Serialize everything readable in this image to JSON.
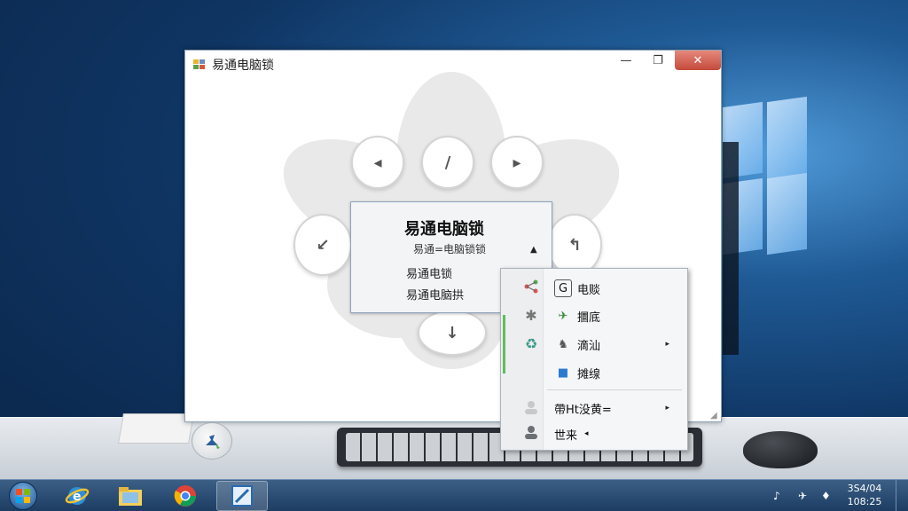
{
  "window": {
    "title": "易通电脑锁",
    "minimize": "—",
    "maximize": "❐",
    "close": "✕"
  },
  "flower_buttons": [
    "◂",
    "/",
    "▸",
    "↙",
    "↰",
    "↓"
  ],
  "panel": {
    "title": "易通电脑锁",
    "subtitle": "易通=电脑锁锁",
    "arrow": "▲",
    "line1": "易通电锁",
    "line2": "易通电脑拱"
  },
  "context_menu": {
    "items": [
      {
        "icon": "G",
        "label": "电赕",
        "has_sub": false
      },
      {
        "icon": "✈",
        "label": "攌底",
        "has_sub": false
      },
      {
        "icon": "♞",
        "label": "滴汕",
        "has_sub": true
      },
      {
        "icon": "■",
        "label": "摊缐",
        "has_sub": false
      }
    ],
    "bottom_items": [
      {
        "label": "帶Ht没黄=",
        "has_sub": true
      },
      {
        "label": "世来",
        "has_sub": true
      }
    ],
    "sub_arrow": "▸",
    "back_arrow": "◂"
  },
  "taskbar": {
    "start_glyph": "⊞",
    "apps": [
      {
        "name": "ie-icon",
        "glyph": "e"
      },
      {
        "name": "folder-icon",
        "glyph": "▤"
      },
      {
        "name": "chrome-icon",
        "glyph": "◉"
      },
      {
        "name": "lock-app-icon",
        "glyph": "◩"
      }
    ],
    "tray_icons": [
      "♪",
      "✈",
      "♦"
    ],
    "clock_line1": "3S4/04",
    "clock_line2": "108:25"
  },
  "colors": {
    "close_button": "#c44a3b",
    "taskbar": "#1d3d63",
    "menu_accent": "#5cbf5c"
  }
}
